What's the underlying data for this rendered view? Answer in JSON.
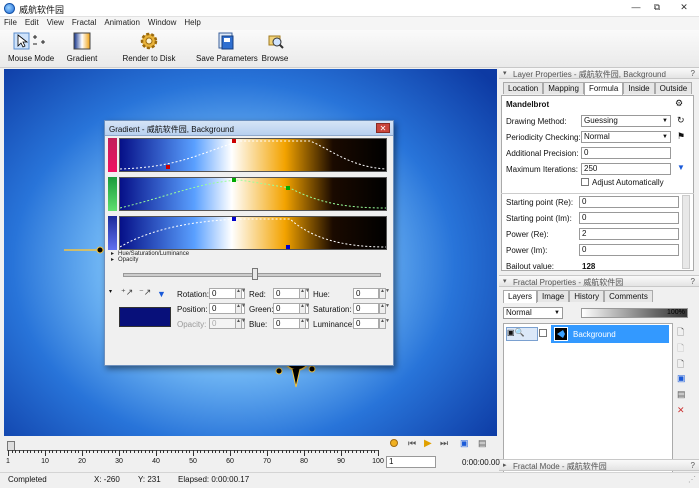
{
  "window": {
    "title": "威航软件园",
    "minimize_label": "—",
    "maximize_label": "⧉",
    "close_label": "✕"
  },
  "menu": [
    "File",
    "Edit",
    "View",
    "Fractal",
    "Animation",
    "Window",
    "Help"
  ],
  "toolbar": [
    {
      "label": "Mouse Mode",
      "icon": "mouse-pointer-icon"
    },
    {
      "label": "Gradient",
      "icon": "gradient-icon"
    },
    {
      "label": "Render to Disk",
      "icon": "gear-icon"
    },
    {
      "label": "Save Parameters",
      "icon": "save-parameters-icon"
    },
    {
      "label": "Browse",
      "icon": "browse-icon"
    }
  ],
  "gradient_dialog": {
    "title": "Gradient - 威航软件园, Background",
    "close_label": "✕",
    "expanders": [
      "Hue/Saturation/Luminance",
      "Opacity"
    ],
    "fields_left": [
      {
        "label": "Rotation:",
        "value": "0",
        "disabled": false
      },
      {
        "label": "Position:",
        "value": "0",
        "disabled": false
      },
      {
        "label": "Opacity:",
        "value": "0",
        "disabled": true
      }
    ],
    "fields_mid": [
      {
        "label": "Red:",
        "value": "0"
      },
      {
        "label": "Green:",
        "value": "0"
      },
      {
        "label": "Blue:",
        "value": "0"
      }
    ],
    "fields_right": [
      {
        "label": "Hue:",
        "value": "0"
      },
      {
        "label": "Saturation:",
        "value": "0"
      },
      {
        "label": "Luminance:",
        "value": "0"
      }
    ],
    "swatch_color": "#08107a"
  },
  "layer_properties": {
    "header": "Layer Properties - 威航软件园, Background",
    "tabs": [
      "Location",
      "Mapping",
      "Formula",
      "Inside",
      "Outside"
    ],
    "active_tab": "Formula",
    "formula_name": "Mandelbrot",
    "rows": [
      {
        "label": "Drawing Method:",
        "value": "Guessing",
        "type": "combo"
      },
      {
        "label": "Periodicity Checking:",
        "value": "Normal",
        "type": "combo"
      },
      {
        "label": "Additional Precision:",
        "value": "0",
        "type": "spin"
      },
      {
        "label": "Maximum Iterations:",
        "value": "250",
        "type": "spin"
      }
    ],
    "adjust_label": "Adjust Automatically",
    "params": [
      {
        "label": "Starting point (Re):",
        "value": "0"
      },
      {
        "label": "Starting point (Im):",
        "value": "0"
      },
      {
        "label": "Power (Re):",
        "value": "2"
      },
      {
        "label": "Power (Im):",
        "value": "0"
      },
      {
        "label": "Bailout value:",
        "value": "128"
      }
    ]
  },
  "fractal_properties": {
    "header": "Fractal Properties - 威航软件园",
    "tabs": [
      "Layers",
      "Image",
      "History",
      "Comments"
    ],
    "active_tab": "Layers",
    "blend_mode": "Normal",
    "opacity": "100%",
    "layer_name": "Background"
  },
  "fractal_mode": {
    "header": "Fractal Mode - 威航软件园"
  },
  "timeline": {
    "ticks": [
      "1",
      "10",
      "20",
      "30",
      "40",
      "50",
      "60",
      "70",
      "80",
      "90",
      "100"
    ],
    "frame": "1",
    "time": "0:00:00.00"
  },
  "status": {
    "state": "Completed",
    "x": "X: -260",
    "y": "Y: 231",
    "elapsed": "Elapsed: 0:00:00.17"
  },
  "colors": {
    "accent": "#1a6fd8",
    "selection": "#3399ff",
    "canvas_bg": "#2a78da"
  }
}
